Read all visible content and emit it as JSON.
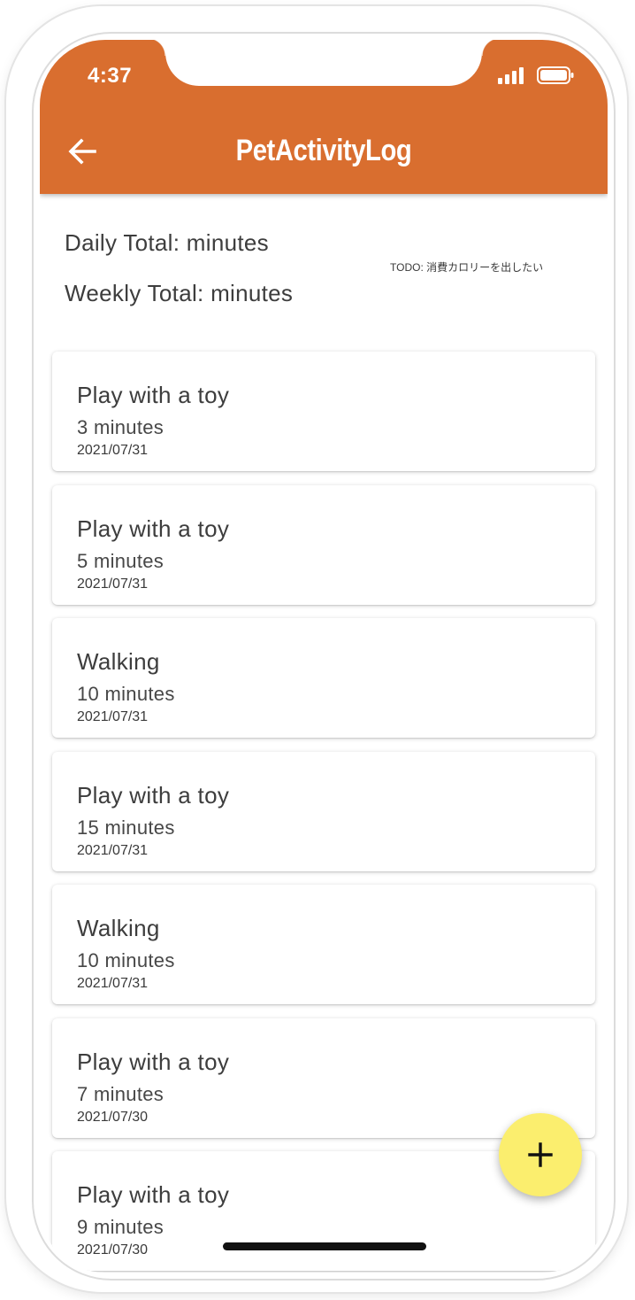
{
  "status_bar": {
    "time": "4:37",
    "signal_icon": "cellular-signal-icon",
    "battery_icon": "battery-icon"
  },
  "app_bar": {
    "back_icon": "arrow-left-icon",
    "title": "PetActivityLog",
    "color": "#d96e2f"
  },
  "summary": {
    "daily_total": "Daily Total:  minutes",
    "weekly_total": "Weekly Total:  minutes",
    "todo_note": "TODO: 消費カロリーを出したい"
  },
  "activities": [
    {
      "title": "Play with a toy",
      "minutes": "3 minutes",
      "date": "2021/07/31"
    },
    {
      "title": "Play with a toy",
      "minutes": "5 minutes",
      "date": "2021/07/31"
    },
    {
      "title": "Walking",
      "minutes": "10 minutes",
      "date": "2021/07/31"
    },
    {
      "title": "Play with a toy",
      "minutes": "15 minutes",
      "date": "2021/07/31"
    },
    {
      "title": "Walking",
      "minutes": "10 minutes",
      "date": "2021/07/31"
    },
    {
      "title": "Play with a toy",
      "minutes": "7 minutes",
      "date": "2021/07/30"
    },
    {
      "title": "Play with a toy",
      "minutes": "9 minutes",
      "date": "2021/07/30"
    }
  ],
  "fab": {
    "icon": "plus-icon",
    "color": "#fbee6e"
  }
}
